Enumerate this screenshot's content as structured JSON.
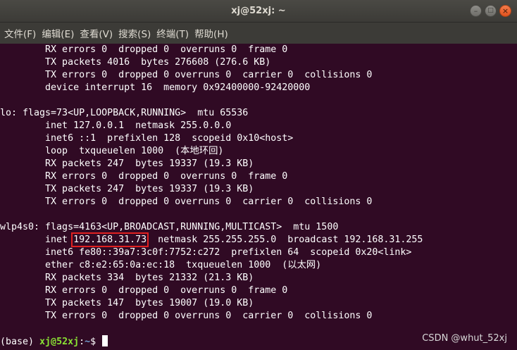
{
  "window": {
    "title": "xj@52xj: ~"
  },
  "menu": {
    "items": [
      "文件(F)",
      "编辑(E)",
      "查看(V)",
      "搜索(S)",
      "终端(T)",
      "帮助(H)"
    ]
  },
  "terminal": {
    "lines": [
      {
        "text": "        RX errors 0  dropped 0  overruns 0  frame 0"
      },
      {
        "text": "        TX packets 4016  bytes 276608 (276.6 KB)"
      },
      {
        "text": "        TX errors 0  dropped 0 overruns 0  carrier 0  collisions 0"
      },
      {
        "text": "        device interrupt 16  memory 0x92400000-92420000"
      },
      {
        "text": ""
      },
      {
        "text": "lo: flags=73<UP,LOOPBACK,RUNNING>  mtu 65536"
      },
      {
        "text": "        inet 127.0.0.1  netmask 255.0.0.0"
      },
      {
        "text": "        inet6 ::1  prefixlen 128  scopeid 0x10<host>"
      },
      {
        "text": "        loop  txqueuelen 1000  (本地环回)"
      },
      {
        "text": "        RX packets 247  bytes 19337 (19.3 KB)"
      },
      {
        "text": "        RX errors 0  dropped 0  overruns 0  frame 0"
      },
      {
        "text": "        TX packets 247  bytes 19337 (19.3 KB)"
      },
      {
        "text": "        TX errors 0  dropped 0 overruns 0  carrier 0  collisions 0"
      },
      {
        "text": ""
      },
      {
        "text": "wlp4s0: flags=4163<UP,BROADCAST,RUNNING,MULTICAST>  mtu 1500"
      },
      {
        "pre": "        inet ",
        "highlight": "192.168.31.73",
        "post": "  netmask 255.255.255.0  broadcast 192.168.31.255"
      },
      {
        "text": "        inet6 fe80::39a7:3c0f:7752:c272  prefixlen 64  scopeid 0x20<link>"
      },
      {
        "text": "        ether c8:e2:65:0a:ec:18  txqueuelen 1000  (以太网)"
      },
      {
        "text": "        RX packets 334  bytes 21332 (21.3 KB)"
      },
      {
        "text": "        RX errors 0  dropped 0  overruns 0  frame 0"
      },
      {
        "text": "        TX packets 147  bytes 19007 (19.0 KB)"
      },
      {
        "text": "        TX errors 0  dropped 0 overruns 0  carrier 0  collisions 0"
      },
      {
        "text": ""
      }
    ],
    "prompt": {
      "env": "(base) ",
      "user_host": "xj@52xj",
      "separator": ":",
      "path": "~",
      "symbol": "$ "
    }
  },
  "watermark": "CSDN @whut_52xj",
  "colors": {
    "background": "#300a24",
    "text": "#ffffff",
    "prompt_user": "#8ae234",
    "prompt_path": "#729fcf",
    "highlight_box": "#e02020"
  },
  "icons": {
    "minimize": "minimize-icon",
    "maximize": "maximize-icon",
    "close": "close-icon"
  }
}
